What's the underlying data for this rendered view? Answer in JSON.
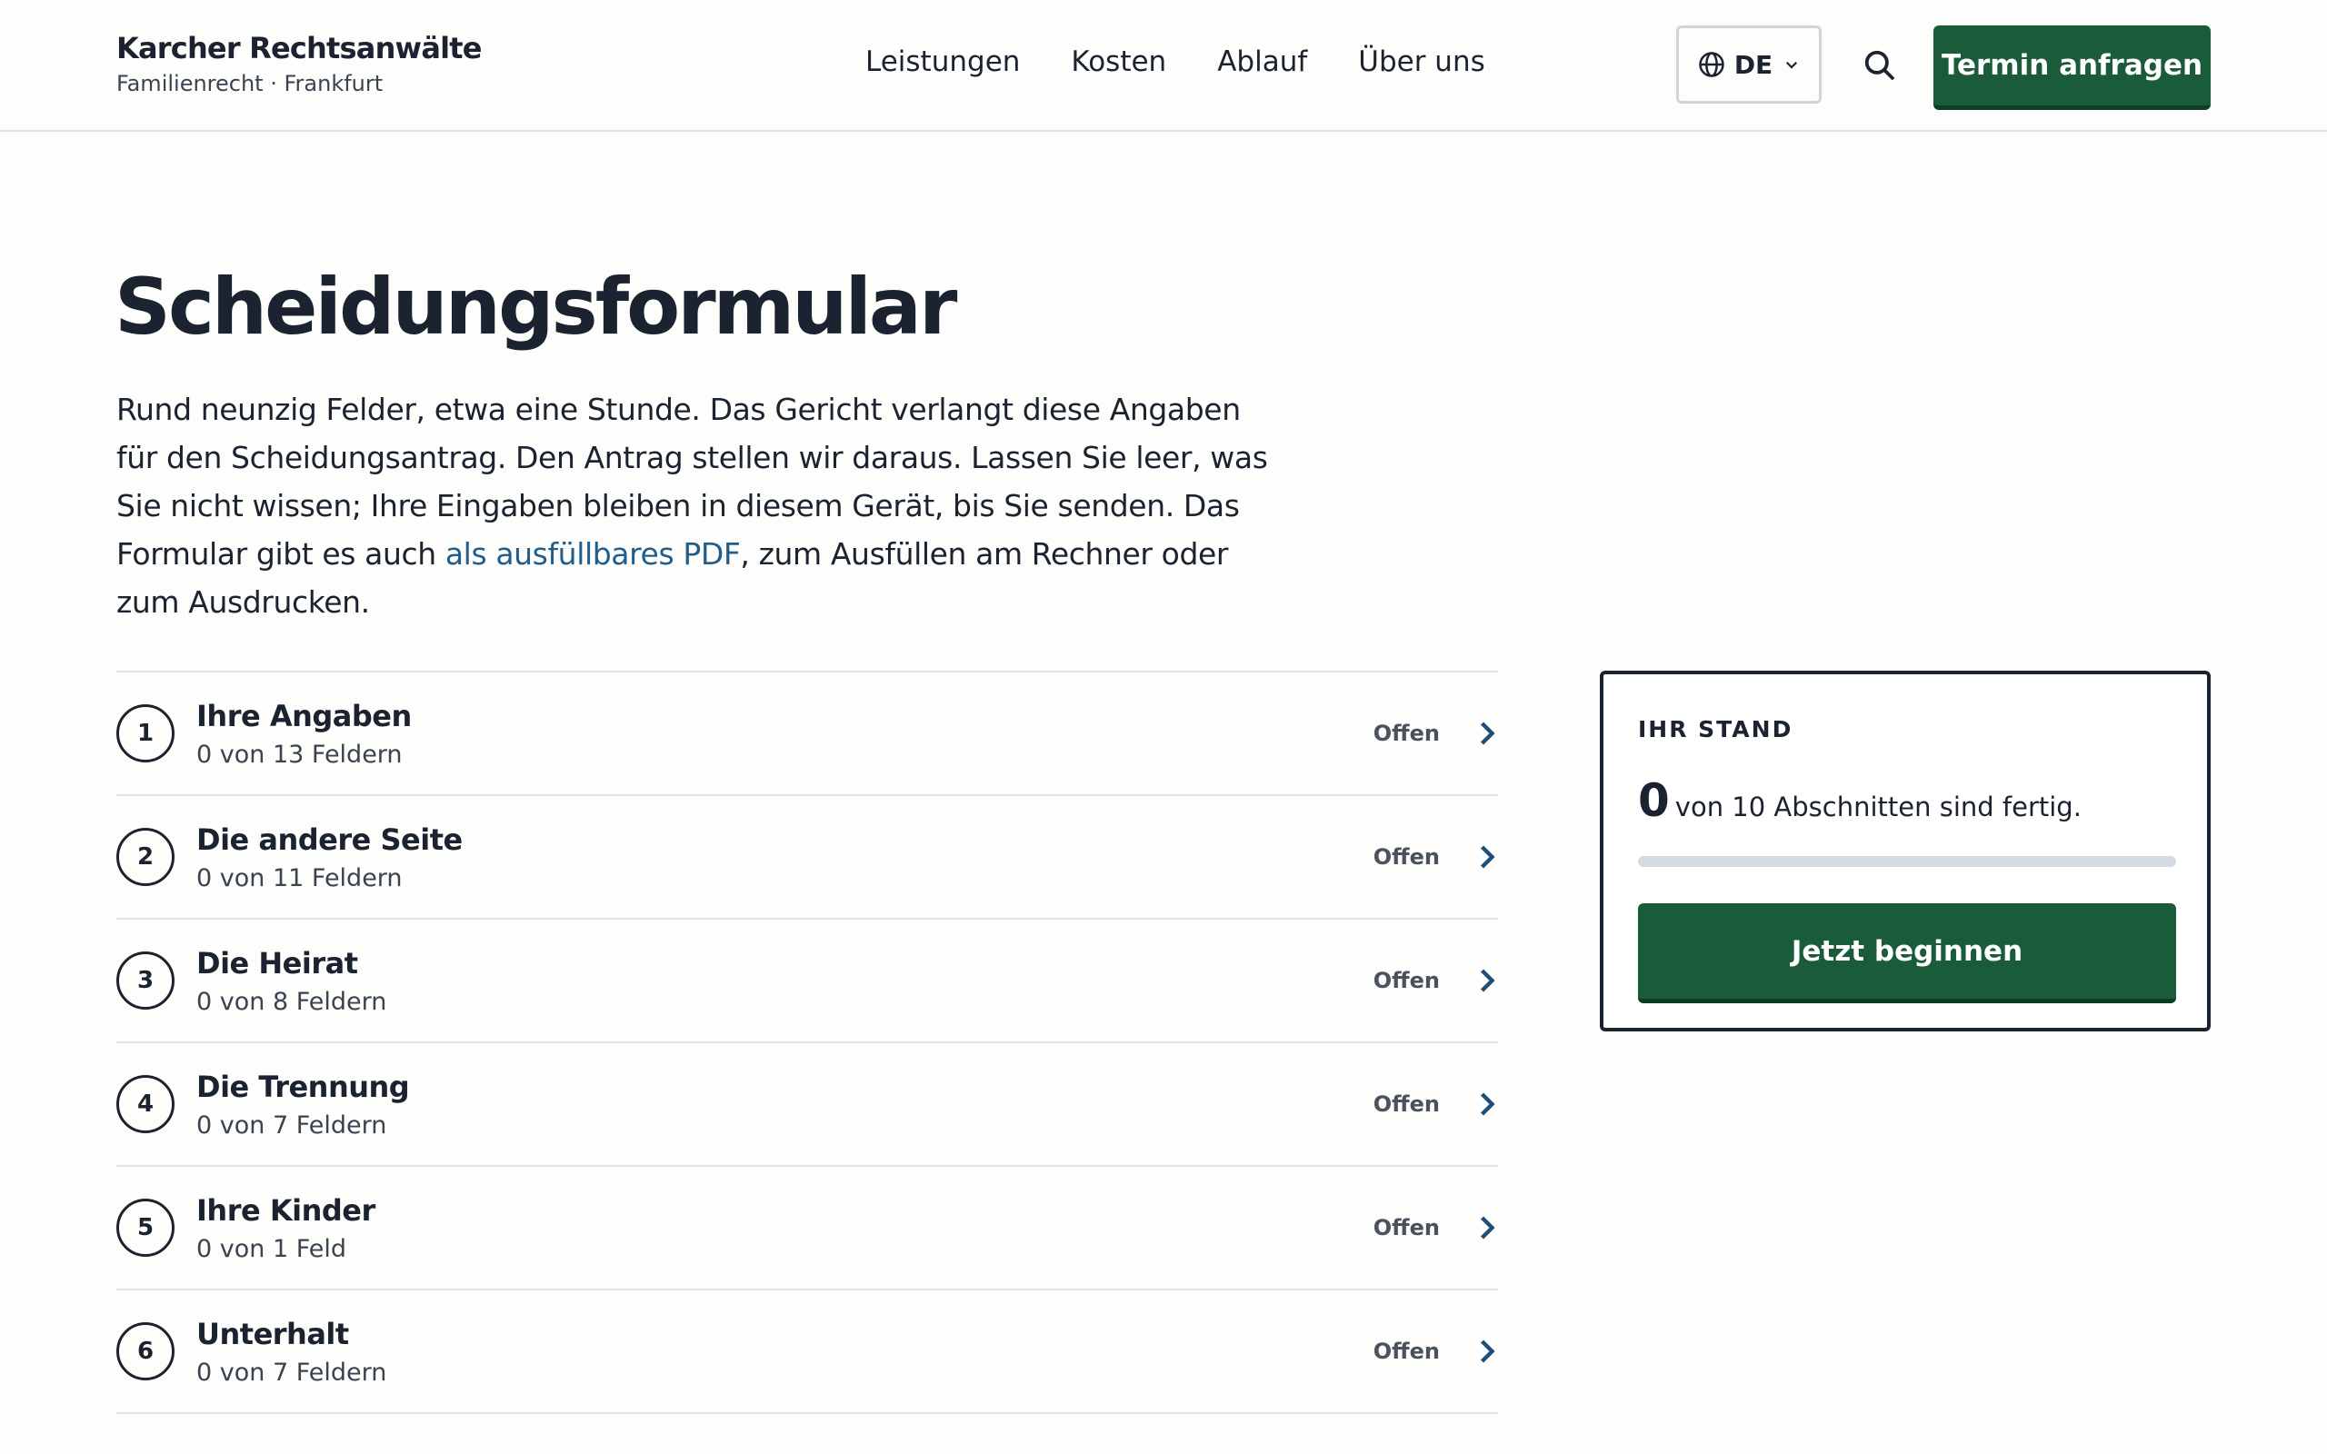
{
  "header": {
    "brand_name": "Karcher Rechtsanwälte",
    "brand_sub": "Familienrecht · Frankfurt",
    "nav": [
      "Leistungen",
      "Kosten",
      "Ablauf",
      "Über uns"
    ],
    "lang_label": "DE",
    "cta_label": "Termin anfragen"
  },
  "main": {
    "title": "Scheidungsformular",
    "intro_before": "Rund neunzig Felder, etwa eine Stunde. Das Gericht verlangt diese Angaben für den Scheidungsantrag. Den Antrag stellen wir daraus. Lassen Sie leer, was Sie nicht wissen; Ihre Eingaben bleiben in diesem Gerät, bis Sie senden. Das Formular gibt es auch ",
    "intro_link": "als ausfüllbares PDF",
    "intro_after": ", zum Ausfüllen am Rechner oder zum Ausdrucken."
  },
  "sections": [
    {
      "num": "1",
      "title": "Ihre Angaben",
      "count": "0 von 13 Feldern",
      "status": "Offen"
    },
    {
      "num": "2",
      "title": "Die andere Seite",
      "count": "0 von 11 Feldern",
      "status": "Offen"
    },
    {
      "num": "3",
      "title": "Die Heirat",
      "count": "0 von 8 Feldern",
      "status": "Offen"
    },
    {
      "num": "4",
      "title": "Die Trennung",
      "count": "0 von 7 Feldern",
      "status": "Offen"
    },
    {
      "num": "5",
      "title": "Ihre Kinder",
      "count": "0 von 1 Feld",
      "status": "Offen"
    },
    {
      "num": "6",
      "title": "Unterhalt",
      "count": "0 von 7 Feldern",
      "status": "Offen"
    }
  ],
  "panel": {
    "label": "IHR STAND",
    "done": "0",
    "text": "von 10 Abschnitten sind fertig.",
    "progress": 0,
    "button_label": "Jetzt beginnen"
  },
  "colors": {
    "accent": "#1a5c3a",
    "link": "#1f5e8c",
    "text": "#1b2330",
    "background": "#fdfdfb"
  }
}
